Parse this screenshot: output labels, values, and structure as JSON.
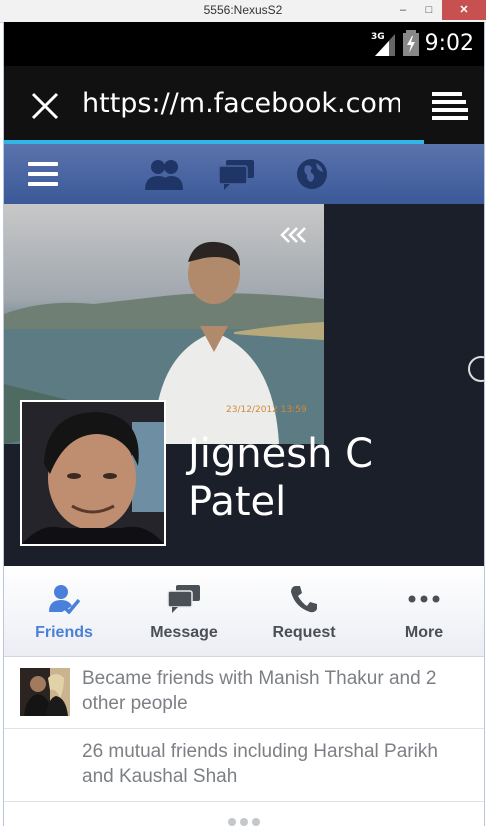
{
  "window": {
    "title": "5556:NexusS2",
    "minimize": "–",
    "maximize": "□",
    "close": "✕"
  },
  "status_bar": {
    "network": "3G",
    "time": "9:02"
  },
  "browser": {
    "url": "https://m.facebook.com/pa"
  },
  "nav": {
    "icons": [
      "menu-icon",
      "friends-icon",
      "messages-icon",
      "notifications-globe-icon"
    ]
  },
  "profile": {
    "name": "Jignesh C Patel",
    "cover_date_stamp": "23/12/2012 13:59"
  },
  "actions": [
    {
      "label": "Friends",
      "icon": "friends-check-icon",
      "active": true
    },
    {
      "label": "Message",
      "icon": "message-icon",
      "active": false
    },
    {
      "label": "Request",
      "icon": "phone-icon",
      "active": false
    },
    {
      "label": "More",
      "icon": "more-icon",
      "active": false
    }
  ],
  "stories": [
    {
      "text": "Became friends with Manish Thakur and 2 other people"
    },
    {
      "text": "26 mutual friends including Harshal Parikh and Kaushal Shah"
    }
  ],
  "colors": {
    "facebook_blue": "#3b5998",
    "accent": "#4a80d9",
    "progress": "#33b5e5"
  }
}
